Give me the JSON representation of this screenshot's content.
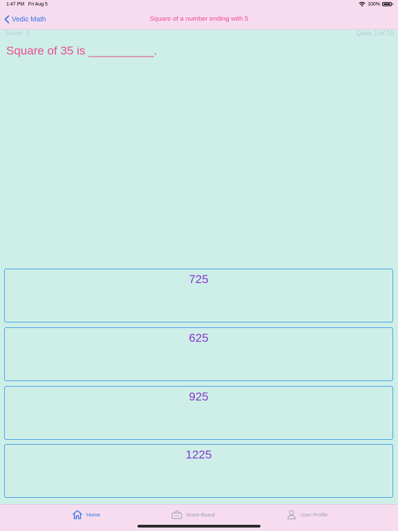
{
  "status": {
    "time": "1:47 PM",
    "date": "Fri Aug 5",
    "battery": "100%",
    "battery_level": 1.0
  },
  "nav": {
    "back_label": "Vedic Math",
    "title": "Square of a  number ending with 5"
  },
  "quiz": {
    "score": "Score: 0",
    "progress": "Ques 1 of 10",
    "question": "Square of 35 is __________.",
    "options": [
      "725",
      "625",
      "925",
      "1225"
    ]
  },
  "tabs": [
    {
      "label": "Home",
      "icon": "home-icon",
      "active": true
    },
    {
      "label": "Score Board",
      "icon": "scoreboard-icon",
      "active": false
    },
    {
      "label": "User Profile",
      "icon": "user-icon",
      "active": false
    }
  ],
  "colors": {
    "background": "#cdefe8",
    "bar": "#f7dcef",
    "accent": "#2f73e6",
    "title": "#ea4d8e",
    "option_text": "#8a35c9",
    "option_border": "#4da0e6"
  }
}
